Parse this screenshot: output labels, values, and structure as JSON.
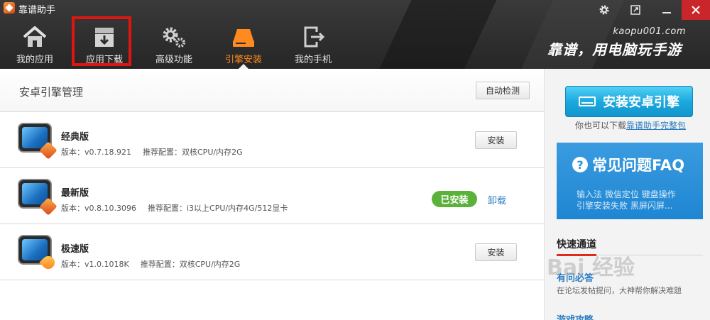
{
  "window": {
    "title": "靠谱助手",
    "settings_icon": "gear-icon",
    "restore_icon": "restore-icon",
    "minimize_icon": "minimize-icon",
    "close_icon": "close-icon"
  },
  "nav": [
    {
      "label": "我的应用",
      "icon": "home-icon"
    },
    {
      "label": "应用下载",
      "icon": "download-box-icon"
    },
    {
      "label": "高级功能",
      "icon": "gears-icon"
    },
    {
      "label": "引擎安装",
      "icon": "drive-icon",
      "active": true
    },
    {
      "label": "我的手机",
      "icon": "phone-export-icon"
    }
  ],
  "brand": {
    "url": "kaopu001.com",
    "slogan": "靠谱，用电脑玩手游"
  },
  "main": {
    "title": "安卓引擎管理",
    "auto_detect_label": "自动检测",
    "engines": [
      {
        "name": "经典版",
        "version": "版本：v0.7.18.921",
        "config": "推荐配置：双核CPU/内存2G",
        "action": "安装"
      },
      {
        "name": "最新版",
        "version": "版本：v0.8.10.3096",
        "config": "推荐配置：i3以上CPU/内存4G/512显卡",
        "status": "已安装",
        "action": "卸载"
      },
      {
        "name": "极速版",
        "version": "版本：v1.0.1018K",
        "config": "推荐配置：双核CPU/内存2G",
        "action": "安装"
      }
    ]
  },
  "sidebar": {
    "install_button": "安装安卓引擎",
    "download_hint": "你也可以下载",
    "download_link": "靠谱助手完整包",
    "faq": {
      "title": "常见问题FAQ",
      "line1": "输入法  微信定位  键盘操作",
      "line2": "引擎安装失败  黑屏闪屏..."
    },
    "quick": {
      "title": "快速通道",
      "link1_title": "有问必答",
      "link1_desc": "在论坛发帖提问，大神帮你解决难题",
      "link2_title": "游戏攻略"
    }
  },
  "watermark": "Bai 经验",
  "colors": {
    "accent_orange": "#ff8a1e",
    "installed_green": "#5bb23a",
    "link_blue": "#2a7bc0",
    "install_button_blue": "#1ba9df",
    "highlight_red": "#e1150f"
  }
}
